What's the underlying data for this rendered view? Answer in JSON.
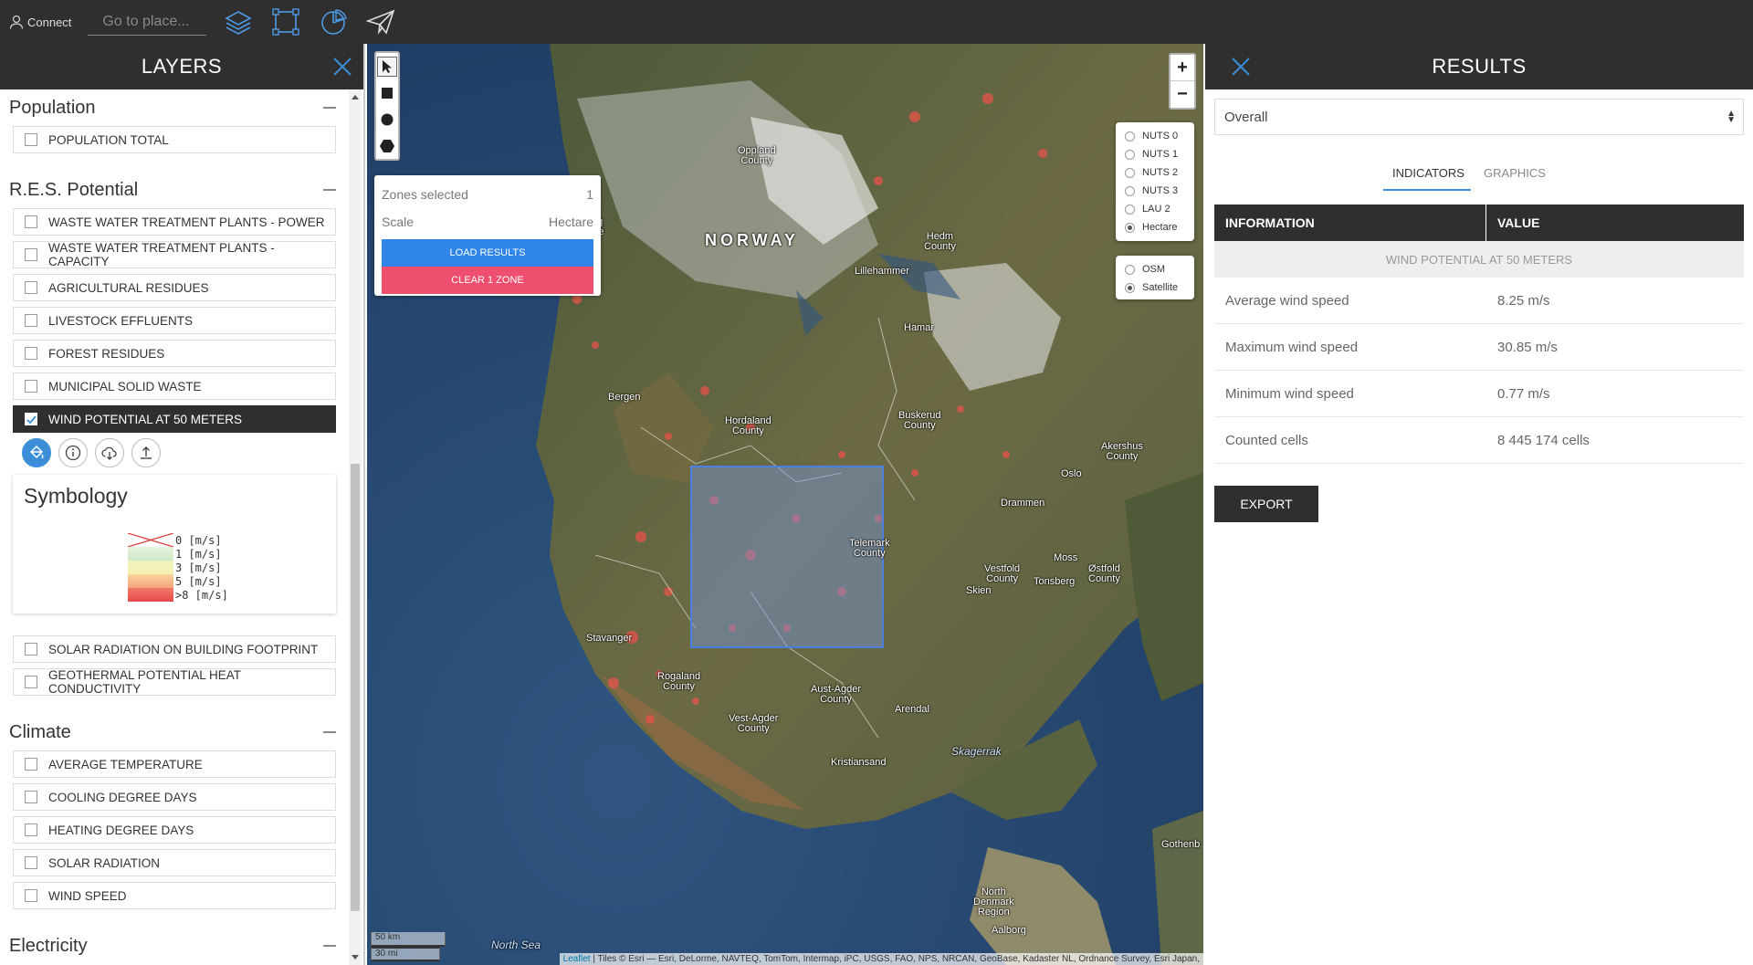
{
  "topbar": {
    "connect_label": "Connect",
    "search_placeholder": "Go to place..."
  },
  "layers_panel": {
    "title": "LAYERS",
    "groups": [
      {
        "title": "Population",
        "items": [
          "POPULATION TOTAL"
        ]
      },
      {
        "title": "R.E.S. Potential",
        "items": [
          "WASTE WATER TREATMENT PLANTS - POWER",
          "WASTE WATER TREATMENT PLANTS - CAPACITY",
          "AGRICULTURAL RESIDUES",
          "LIVESTOCK EFFLUENTS",
          "FOREST RESIDUES",
          "MUNICIPAL SOLID WASTE",
          "WIND POTENTIAL AT 50 METERS",
          "SOLAR RADIATION ON BUILDING FOOTPRINT",
          "GEOTHERMAL POTENTIAL HEAT CONDUCTIVITY"
        ]
      },
      {
        "title": "Climate",
        "items": [
          "AVERAGE TEMPERATURE",
          "COOLING DEGREE DAYS",
          "HEATING DEGREE DAYS",
          "SOLAR RADIATION",
          "WIND SPEED"
        ]
      },
      {
        "title": "Electricity",
        "items": []
      }
    ],
    "active_layer": "WIND POTENTIAL AT 50 METERS",
    "symbology": {
      "title": "Symbology",
      "legend": [
        {
          "label": "0  [m/s]",
          "color": "none"
        },
        {
          "label": "1  [m/s]",
          "color": "#cde7c4"
        },
        {
          "label": "3  [m/s]",
          "color": "#f4f0b0"
        },
        {
          "label": "5  [m/s]",
          "color": "#f6b98a"
        },
        {
          "label": ">8  [m/s]",
          "color": "#e8494a"
        }
      ]
    }
  },
  "map": {
    "zones": {
      "selected_label": "Zones selected",
      "selected_value": "1",
      "scale_label": "Scale",
      "scale_value": "Hectare",
      "load_button": "LOAD RESULTS",
      "clear_button": "CLEAR 1 ZONE"
    },
    "zoom_in": "+",
    "zoom_out": "−",
    "scale_levels": [
      "NUTS 0",
      "NUTS 1",
      "NUTS 2",
      "NUTS 3",
      "LAU 2",
      "Hectare"
    ],
    "selected_scale": "Hectare",
    "basemaps": [
      "OSM",
      "Satellite"
    ],
    "selected_basemap": "Satellite",
    "labels": {
      "norway": "NORWAY",
      "oppland": "Oppland\nCounty",
      "sogn": "Sogn og\nFjordane\nCounty",
      "hedmark": "Hedm\nCounty",
      "lillehammer": "Lillehammer",
      "hamar": "Hamar",
      "bergen": "Bergen",
      "hordaland": "Hordaland\nCounty",
      "buskerud": "Buskerud\nCounty",
      "akershus": "Akershus\nCounty",
      "oslo": "Oslo",
      "drammen": "Drammen",
      "telemark": "Telemark\nCounty",
      "moss": "Moss",
      "vestfold": "Vestfold\nCounty",
      "ostfold": "Østfold\nCounty",
      "tonsberg": "Tonsberg",
      "skien": "Skien",
      "stavanger": "Stavanger",
      "rogaland": "Rogaland\nCounty",
      "aust_agder": "Aust-Agder\nCounty",
      "arendal": "Arendal",
      "vest_agder": "Vest-Agder\nCounty",
      "skagerrak": "Skagerrak",
      "kristiansand": "Kristiansand",
      "gothenburg": "Gothenb",
      "north_denmark": "North\nDenmark\nRegion",
      "aalborg": "Aalborg",
      "north_sea": "North Sea"
    },
    "scalebar_km": "50 km",
    "scalebar_mi": "30 mi",
    "attribution_link": "Leaflet",
    "attribution_text": " | Tiles © Esri — Esri, DeLorme, NAVTEQ, TomTom, Intermap, iPC, USGS, FAO, NPS, NRCAN, GeoBase, Kadaster NL, Ordnance Survey, Esri Japan,"
  },
  "results_panel": {
    "title": "RESULTS",
    "select_value": "Overall",
    "tabs": [
      "INDICATORS",
      "GRAPHICS"
    ],
    "active_tab": "INDICATORS",
    "table": {
      "headers": [
        "INFORMATION",
        "VALUE"
      ],
      "category": "WIND POTENTIAL AT 50 METERS",
      "rows": [
        [
          "Average wind speed",
          "8.25 m/s"
        ],
        [
          "Maximum wind speed",
          "30.85 m/s"
        ],
        [
          "Minimum wind speed",
          "0.77 m/s"
        ],
        [
          "Counted cells",
          "8 445 174 cells"
        ]
      ]
    },
    "export_label": "EXPORT"
  },
  "colors": {
    "dark": "#2f2f2f",
    "accent": "#3b8fd9",
    "load_button": "#2f86e8",
    "clear_button": "#ef4f6e"
  }
}
